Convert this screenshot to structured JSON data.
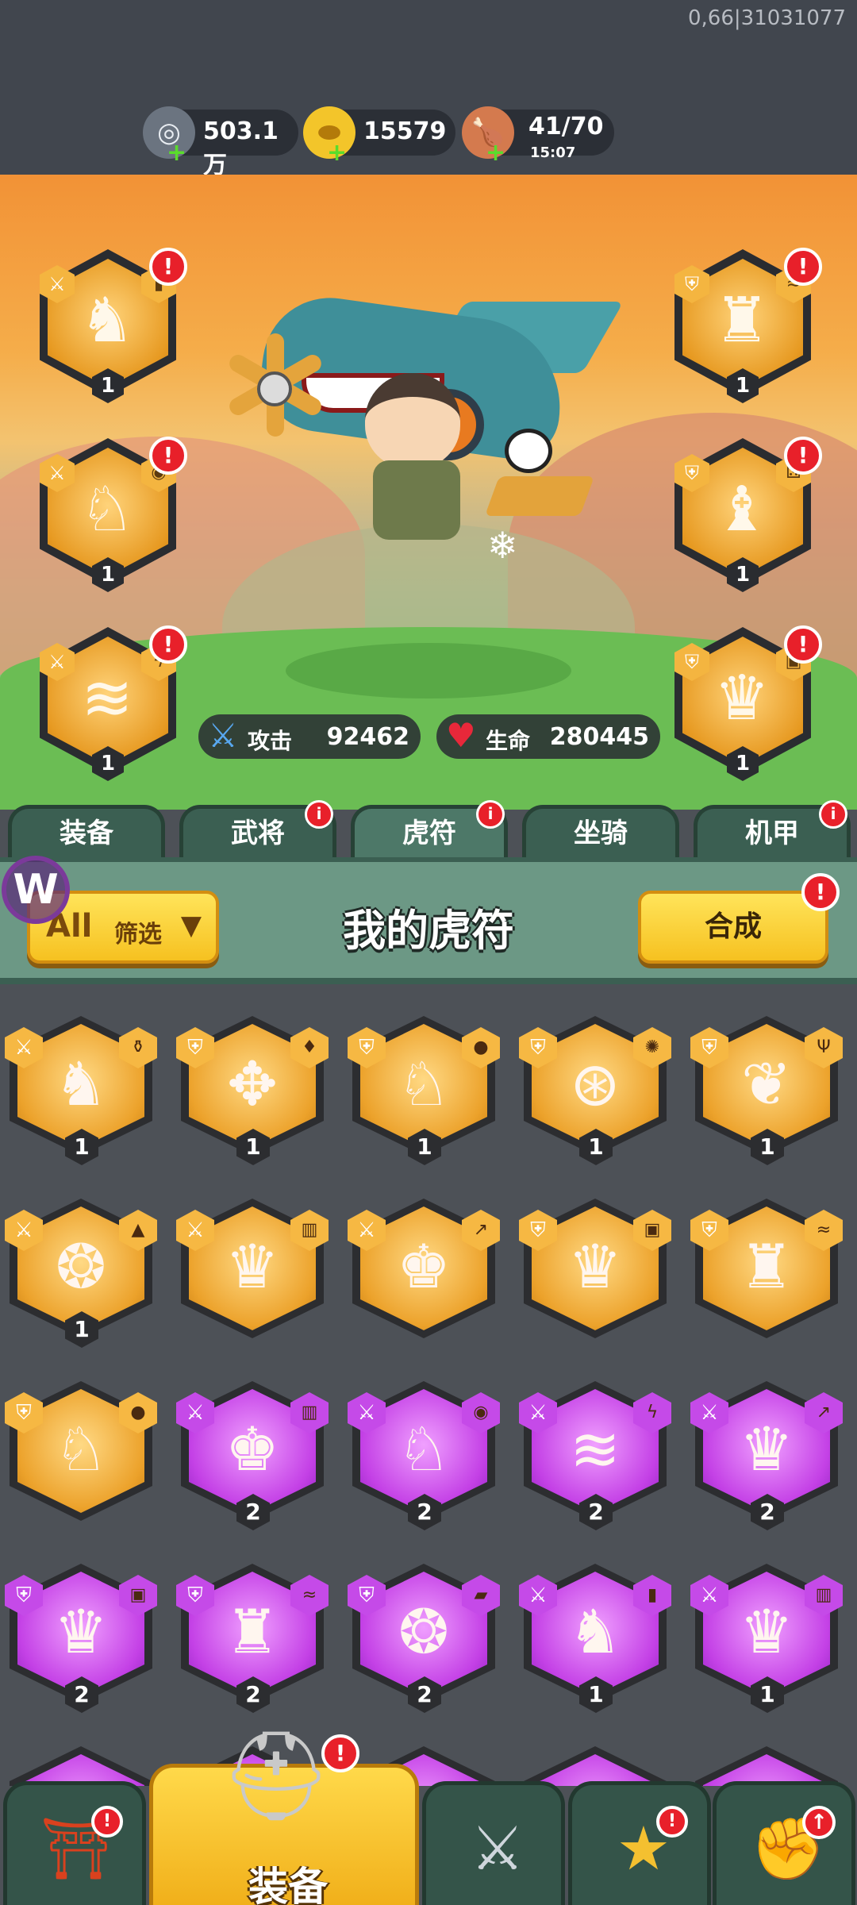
{
  "status": {
    "build_id": "0,66|31031077"
  },
  "resources": {
    "silver": {
      "value": "503.1万",
      "icon": "coin-icon"
    },
    "gold": {
      "value": "15579",
      "icon": "gold-ingot-icon"
    },
    "stamina": {
      "value": "41/70",
      "timer": "15:07",
      "icon": "meat-icon"
    }
  },
  "hero_slots": [
    {
      "level": "1",
      "type": "sword",
      "element": "card",
      "glyph": "deer"
    },
    {
      "level": "1",
      "type": "sword",
      "element": "shell",
      "glyph": "fox"
    },
    {
      "level": "1",
      "type": "sword",
      "element": "lightning",
      "glyph": "whale"
    },
    {
      "level": "1",
      "type": "shield",
      "element": "water",
      "glyph": "horn"
    },
    {
      "level": "1",
      "type": "shield",
      "element": "dice",
      "glyph": "boar"
    },
    {
      "level": "1",
      "type": "shield",
      "element": "disk",
      "glyph": "dragon"
    }
  ],
  "stats": {
    "attack": {
      "label": "攻击",
      "value": "92462"
    },
    "health": {
      "label": "生命",
      "value": "280445"
    }
  },
  "tabs": [
    {
      "label": "装备",
      "badge": ""
    },
    {
      "label": "武将",
      "badge": "i"
    },
    {
      "label": "虎符",
      "badge": "i"
    },
    {
      "label": "坐骑",
      "badge": ""
    },
    {
      "label": "机甲",
      "badge": "i"
    }
  ],
  "title_bar": {
    "filter_all": "All",
    "filter_label": "筛选",
    "title": "我的虎符",
    "merge_label": "合成",
    "merge_badge": "!"
  },
  "overlay": {
    "logo_letter": "W"
  },
  "talismans": [
    {
      "rarity": "gold",
      "type": "sword",
      "level": "1"
    },
    {
      "rarity": "gold",
      "type": "shield",
      "level": "1"
    },
    {
      "rarity": "gold",
      "type": "shield",
      "level": "1"
    },
    {
      "rarity": "gold",
      "type": "shield",
      "level": "1"
    },
    {
      "rarity": "gold",
      "type": "shield",
      "level": "1"
    },
    {
      "rarity": "gold",
      "type": "sword",
      "level": "1"
    },
    {
      "rarity": "gold",
      "type": "sword",
      "level": ""
    },
    {
      "rarity": "gold",
      "type": "sword",
      "level": ""
    },
    {
      "rarity": "gold",
      "type": "shield",
      "level": ""
    },
    {
      "rarity": "gold",
      "type": "shield",
      "level": ""
    },
    {
      "rarity": "gold",
      "type": "shield",
      "level": ""
    },
    {
      "rarity": "purple",
      "type": "sword",
      "level": "2"
    },
    {
      "rarity": "purple",
      "type": "sword",
      "level": "2"
    },
    {
      "rarity": "purple",
      "type": "sword",
      "level": "2"
    },
    {
      "rarity": "purple",
      "type": "sword",
      "level": "2"
    },
    {
      "rarity": "purple",
      "type": "shield",
      "level": "2"
    },
    {
      "rarity": "purple",
      "type": "shield",
      "level": "2"
    },
    {
      "rarity": "purple",
      "type": "shield",
      "level": "2"
    },
    {
      "rarity": "purple",
      "type": "sword",
      "level": "1"
    },
    {
      "rarity": "purple",
      "type": "sword",
      "level": "1"
    }
  ],
  "bottom_nav": [
    {
      "label": "",
      "icon": "gate-icon",
      "badge": "!"
    },
    {
      "label": "装备",
      "icon": "helmet-icon",
      "badge": "!"
    },
    {
      "label": "",
      "icon": "crossed-swords-icon",
      "badge": ""
    },
    {
      "label": "",
      "icon": "stars-icon",
      "badge": "!"
    },
    {
      "label": "",
      "icon": "fist-upgrade-icon",
      "badge": "↑"
    }
  ],
  "colors": {
    "gold": "#eca22b",
    "purple": "#c441e6",
    "panel_green": "#6c9885",
    "badge_red": "#e8202a"
  }
}
